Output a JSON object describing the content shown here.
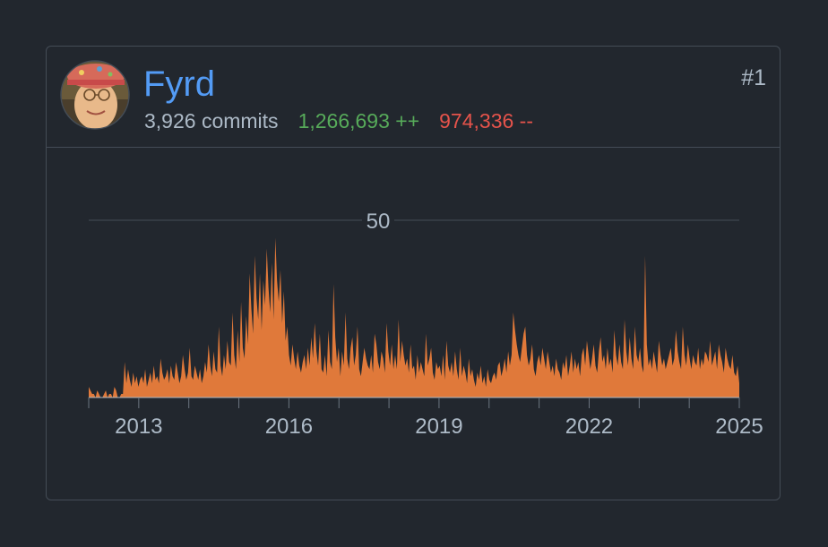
{
  "contributor": {
    "name": "Fyrd",
    "commits": "3,926 commits",
    "additions": "1,266,693 ++",
    "deletions": "974,336 --",
    "rank": "#1"
  },
  "colors": {
    "background": "#22272e",
    "link": "#539bf5",
    "additions": "#57ab5a",
    "deletions": "#e5534b",
    "chart_fill": "#e0793a",
    "muted_text": "#adbac7"
  },
  "chart_data": {
    "type": "area",
    "series": [
      {
        "values": [
          3,
          2,
          1,
          1,
          0,
          2,
          1,
          0,
          0,
          1,
          2,
          0,
          1,
          1,
          0,
          3,
          2,
          0,
          0,
          1,
          1,
          10,
          4,
          8,
          5,
          3,
          7,
          4,
          6,
          3,
          5,
          6,
          4,
          8,
          3,
          5,
          7,
          4,
          9,
          5,
          6,
          4,
          11,
          7,
          5,
          6,
          8,
          4,
          9,
          6,
          5,
          10,
          7,
          4,
          6,
          12,
          8,
          5,
          7,
          14,
          6,
          5,
          9,
          7,
          5,
          8,
          4,
          6,
          10,
          7,
          15,
          9,
          6,
          13,
          8,
          7,
          20,
          9,
          6,
          12,
          8,
          16,
          10,
          9,
          24,
          12,
          8,
          19,
          10,
          27,
          14,
          11,
          23,
          15,
          35,
          25,
          18,
          40,
          28,
          22,
          35,
          19,
          33,
          26,
          42,
          31,
          24,
          38,
          22,
          45,
          33,
          27,
          36,
          21,
          30,
          16,
          20,
          12,
          9,
          15,
          11,
          8,
          13,
          9,
          7,
          10,
          12,
          8,
          14,
          9,
          17,
          11,
          21,
          13,
          9,
          18,
          8,
          7,
          12,
          6,
          19,
          10,
          8,
          32,
          17,
          10,
          14,
          6,
          13,
          9,
          24,
          11,
          8,
          14,
          17,
          9,
          12,
          20,
          8,
          6,
          10,
          14,
          11,
          9,
          8,
          12,
          7,
          18,
          15,
          10,
          8,
          13,
          11,
          7,
          21,
          13,
          9,
          15,
          8,
          12,
          8,
          22,
          10,
          16,
          12,
          9,
          11,
          7,
          15,
          8,
          9,
          5,
          12,
          7,
          10,
          8,
          6,
          18,
          9,
          11,
          14,
          7,
          5,
          10,
          8,
          9,
          6,
          12,
          5,
          16,
          9,
          7,
          10,
          6,
          13,
          8,
          5,
          14,
          6,
          9,
          7,
          4,
          11,
          6,
          8,
          5,
          3,
          7,
          5,
          9,
          4,
          6,
          3,
          8,
          5,
          4,
          6,
          7,
          5,
          9,
          10,
          6,
          8,
          11,
          7,
          13,
          9,
          12,
          24,
          19,
          15,
          12,
          10,
          14,
          18,
          20,
          12,
          9,
          11,
          15,
          8,
          6,
          10,
          12,
          9,
          14,
          11,
          8,
          13,
          10,
          7,
          9,
          6,
          11,
          8,
          7,
          5,
          10,
          8,
          12,
          6,
          9,
          13,
          7,
          11,
          8,
          10,
          6,
          12,
          14,
          9,
          16,
          12,
          8,
          11,
          15,
          9,
          7,
          13,
          17,
          10,
          12,
          8,
          14,
          9,
          11,
          7,
          19,
          12,
          9,
          15,
          10,
          8,
          22,
          13,
          9,
          17,
          11,
          8,
          20,
          12,
          10,
          14,
          9,
          7,
          40,
          15,
          9,
          11,
          8,
          13,
          10,
          7,
          16,
          12,
          9,
          11,
          8,
          10,
          12,
          14,
          9,
          11,
          19,
          13,
          10,
          8,
          20,
          12,
          9,
          15,
          11,
          8,
          12,
          10,
          9,
          14,
          8,
          11,
          9,
          13,
          12,
          10,
          16,
          9,
          11,
          13,
          8,
          15,
          12,
          10,
          7,
          14,
          11,
          9,
          8,
          12,
          7,
          6,
          9,
          4
        ],
        "note": ""
      }
    ],
    "x_start": 2012.0,
    "x_end": 2025.0,
    "xticks": [
      2013,
      2016,
      2019,
      2022,
      2025
    ],
    "ytick": 50,
    "ylim": [
      0,
      100
    ],
    "grid": "single horizontal line at 50"
  }
}
